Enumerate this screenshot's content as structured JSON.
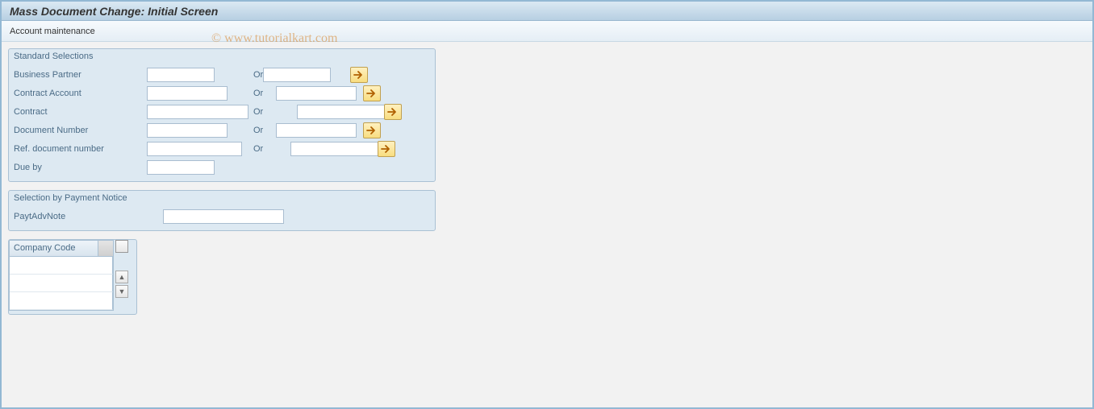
{
  "header": {
    "title": "Mass Document Change: Initial Screen"
  },
  "toolbar": {
    "account_maintenance": "Account maintenance"
  },
  "watermark": "© www.tutorialkart.com",
  "group_standard": {
    "title": "Standard Selections",
    "or": "Or",
    "rows": {
      "business_partner": {
        "label": "Business Partner",
        "val1": "",
        "val2": ""
      },
      "contract_account": {
        "label": "Contract Account",
        "val1": "",
        "val2": ""
      },
      "contract": {
        "label": "Contract",
        "val1": "",
        "val2": ""
      },
      "document_number": {
        "label": "Document Number",
        "val1": "",
        "val2": ""
      },
      "ref_doc_number": {
        "label": "Ref. document number",
        "val1": "",
        "val2": ""
      },
      "due_by": {
        "label": "Due by",
        "val1": ""
      }
    }
  },
  "group_payment": {
    "title": "Selection by Payment Notice",
    "payt_adv_note": {
      "label": "PaytAdvNote",
      "val": ""
    }
  },
  "company_code": {
    "header": "Company Code",
    "rows": [
      "",
      "",
      ""
    ]
  }
}
